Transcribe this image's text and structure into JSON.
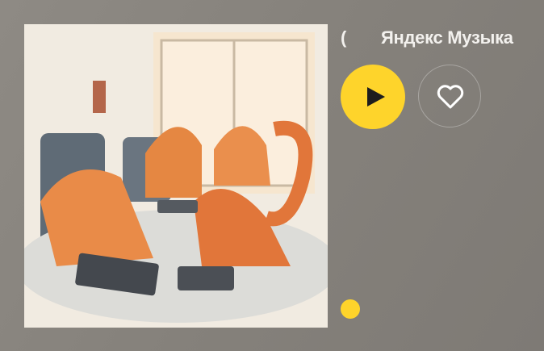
{
  "header": {
    "logo_glyph": "(",
    "brand": "Яндекс Музыка"
  },
  "player": {
    "play_icon": "play-icon",
    "like_icon": "heart-icon"
  },
  "colors": {
    "accent": "#fed42b",
    "background": "#88847e"
  }
}
